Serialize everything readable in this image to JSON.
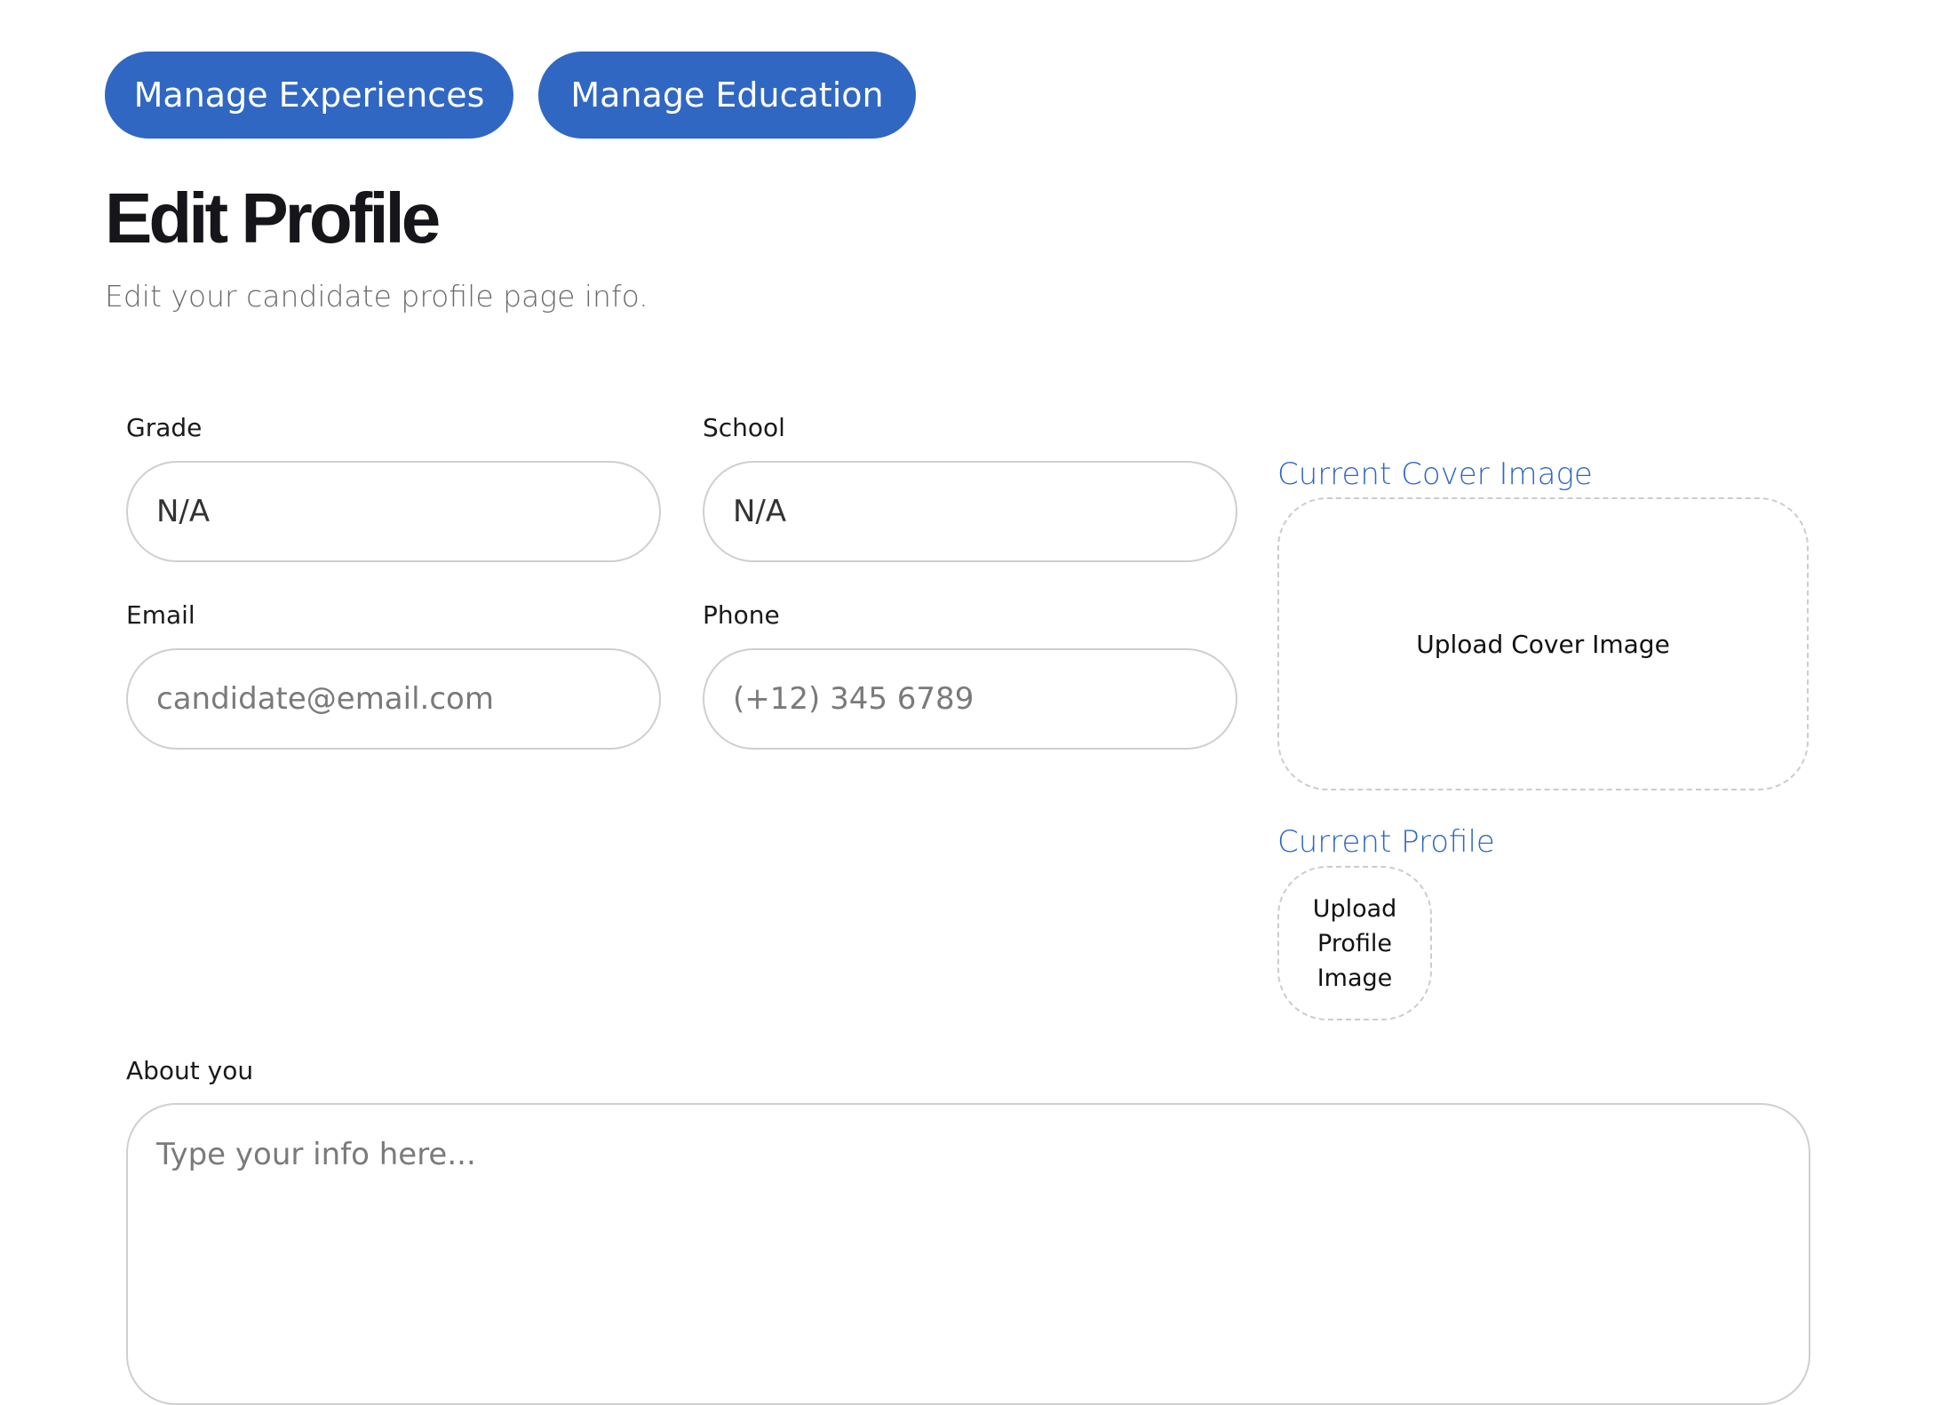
{
  "nav": {
    "manage_experiences": "Manage Experiences",
    "manage_education": "Manage Education"
  },
  "header": {
    "title": "Edit Profile",
    "subtitle": "Edit your candidate profile page info."
  },
  "form": {
    "grade": {
      "label": "Grade",
      "value": "N/A"
    },
    "school": {
      "label": "School",
      "value": "N/A"
    },
    "email": {
      "label": "Email",
      "value": "",
      "placeholder": "candidate@email.com"
    },
    "phone": {
      "label": "Phone",
      "value": "",
      "placeholder": "(+12) 345 6789"
    },
    "about": {
      "label": "About you",
      "value": "",
      "placeholder": "Type your info here..."
    }
  },
  "media": {
    "cover_heading": "Current Cover Image",
    "cover_upload_label": "Upload Cover Image",
    "profile_heading": "Current Profile",
    "profile_upload_label": "Upload Profile Image"
  },
  "colors": {
    "accent": "#2f67c3",
    "border": "#cfcfcf",
    "dashed_border": "#cccccc",
    "title": "#16161a",
    "muted_text": "#6b6b6b"
  }
}
